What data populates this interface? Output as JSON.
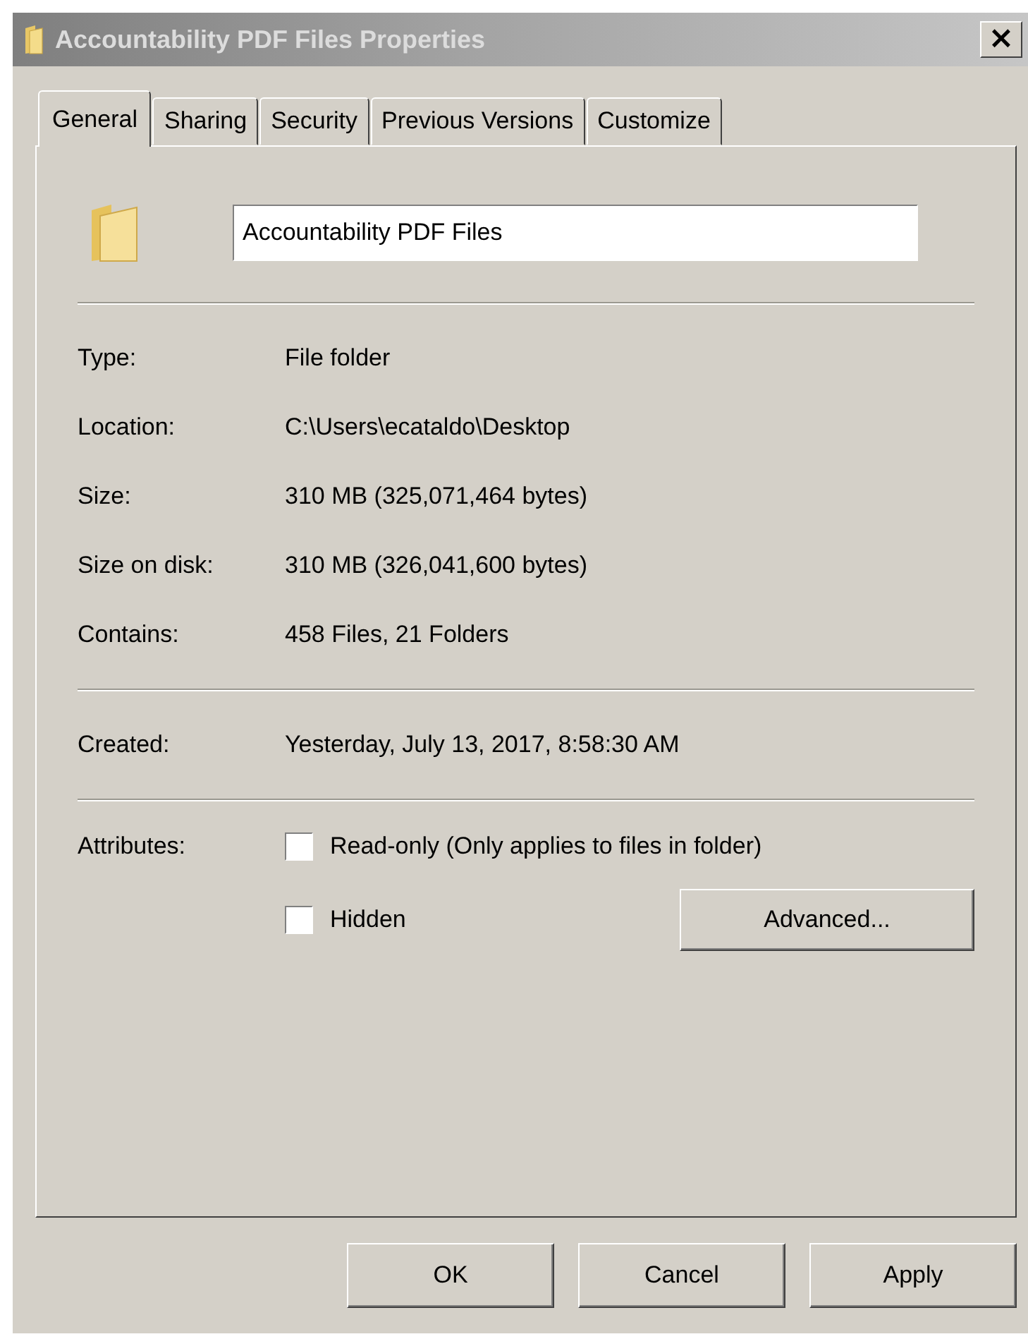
{
  "window": {
    "title": "Accountability PDF Files Properties",
    "close": "×"
  },
  "tabs": [
    {
      "label": "General",
      "selected": true
    },
    {
      "label": "Sharing",
      "selected": false
    },
    {
      "label": "Security",
      "selected": false
    },
    {
      "label": "Previous Versions",
      "selected": false
    },
    {
      "label": "Customize",
      "selected": false
    }
  ],
  "name_field": {
    "value": "Accountability PDF Files"
  },
  "sections": [
    [
      {
        "label": "Type:",
        "value": "File folder"
      },
      {
        "label": "Location:",
        "value": "C:\\Users\\ecataldo\\Desktop"
      },
      {
        "label": "Size:",
        "value": "310 MB (325,071,464 bytes)"
      },
      {
        "label": "Size on disk:",
        "value": "310 MB (326,041,600 bytes)"
      },
      {
        "label": "Contains:",
        "value": "458 Files, 21 Folders"
      }
    ],
    [
      {
        "label": "Created:",
        "value": "Yesterday, July 13, 2017, 8:58:30 AM"
      }
    ]
  ],
  "attributes": {
    "label": "Attributes:",
    "options": [
      {
        "label": "Read-only (Only applies to files in folder)",
        "checked": false
      },
      {
        "label": "Hidden",
        "checked": false
      }
    ],
    "advanced_button": "Advanced..."
  },
  "buttons": [
    "OK",
    "Cancel",
    "Apply"
  ]
}
